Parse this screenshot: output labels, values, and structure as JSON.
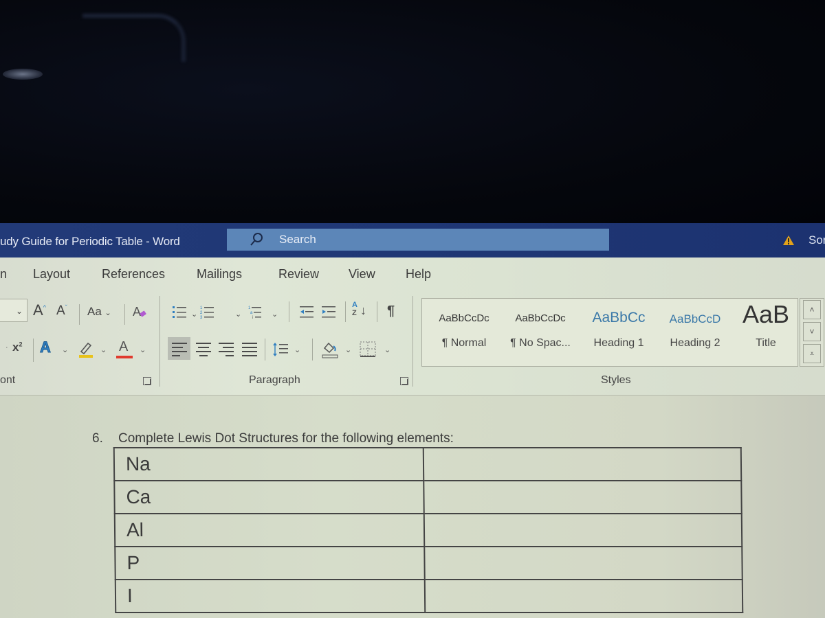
{
  "titlebar": {
    "document_title": "udy Guide for Periodic Table  -  Word",
    "search_placeholder": "Search",
    "account_name": "Sor",
    "warning_icon": "warning-triangle-icon"
  },
  "tabs": [
    {
      "label": "n"
    },
    {
      "label": "Layout"
    },
    {
      "label": "References"
    },
    {
      "label": "Mailings"
    },
    {
      "label": "Review"
    },
    {
      "label": "View"
    },
    {
      "label": "Help"
    }
  ],
  "font_group": {
    "label": "ont",
    "grow_font": "A",
    "shrink_font": "A",
    "change_case": "Aa",
    "superscript": "x",
    "text_effects": "A",
    "font_color": "A",
    "highlight_color": "#e8c21a",
    "font_color_swatch": "#e03a2e"
  },
  "paragraph_group": {
    "label": "Paragraph",
    "pilcrow": "¶",
    "sort_top": "A",
    "sort_bottom": "Z"
  },
  "styles_group": {
    "label": "Styles",
    "items": [
      {
        "preview": "AaBbCcDc",
        "name": "¶ Normal"
      },
      {
        "preview": "AaBbCcDc",
        "name": "¶ No Spac..."
      },
      {
        "preview": "AaBbCc",
        "name": "Heading 1"
      },
      {
        "preview": "AaBbCcD",
        "name": "Heading 2"
      },
      {
        "preview": "AaB",
        "name": "Title"
      }
    ]
  },
  "document": {
    "question_number": "6.",
    "question_text": "Complete Lewis Dot Structures for the following elements:",
    "rows": [
      {
        "element": "Na",
        "answer": ""
      },
      {
        "element": "Ca",
        "answer": ""
      },
      {
        "element": "Al",
        "answer": ""
      },
      {
        "element": "P",
        "answer": ""
      },
      {
        "element": "I",
        "answer": ""
      }
    ]
  },
  "colors": {
    "titlebar": "#203876",
    "search_box": "#5c86b8",
    "accent_blue": "#2f7fc1"
  }
}
